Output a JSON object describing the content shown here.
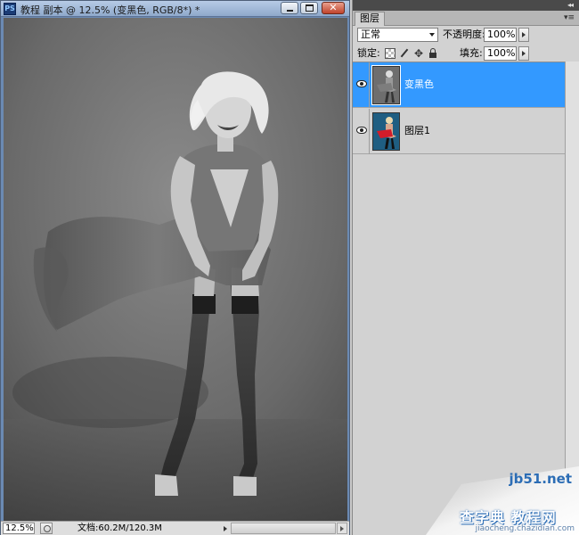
{
  "document_window": {
    "app_icon": "PS",
    "title": "教程 副本 @ 12.5% (变黑色, RGB/8*) *",
    "title_buttons": {
      "minimize": "minimize-icon",
      "maximize": "maximize-icon",
      "close": "close-icon"
    },
    "status": {
      "zoom": "12.5%",
      "doc_info": "文档:60.2M/120.3M"
    }
  },
  "layers_panel": {
    "tab_label": "图层",
    "collapse_glyph": "◂◂",
    "menu_glyph": "▾≡",
    "blend_mode": "正常",
    "opacity_label": "不透明度:",
    "opacity_value": "100%",
    "lock_label": "锁定:",
    "lock_move_glyph": "✥",
    "fill_label": "填充:",
    "fill_value": "100%",
    "layers": [
      {
        "name": "变黑色",
        "visible": true,
        "selected": true,
        "thumbnail": "grayscale-photo"
      },
      {
        "name": "图层1",
        "visible": true,
        "selected": false,
        "thumbnail": "color-photo-red-dress"
      }
    ]
  },
  "watermark": {
    "host": "jb51.net",
    "title": "查字典 教程网",
    "sub": "jiaocheng.chazidian.com"
  },
  "colors": {
    "selection": "#3399ff",
    "panel_bg": "#d2d2d2",
    "titlebar": "#a9bedb"
  }
}
